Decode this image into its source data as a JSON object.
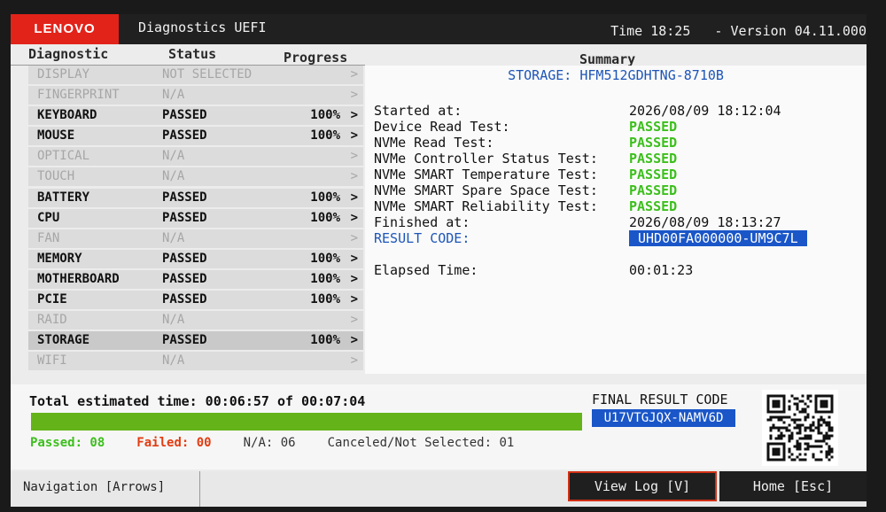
{
  "header": {
    "logo": "LENOVO",
    "title": "Diagnostics UEFI",
    "time": "Time 18:25",
    "version": "Version 04.11.000"
  },
  "columns": {
    "diagnostic": "Diagnostic",
    "status": "Status",
    "progress": "Progress",
    "summary": "Summary"
  },
  "devices": [
    {
      "name": "DISPLAY",
      "status": "NOT SELECTED",
      "progress": "",
      "enabled": false
    },
    {
      "name": "FINGERPRINT",
      "status": "N/A",
      "progress": "",
      "enabled": false
    },
    {
      "name": "KEYBOARD",
      "status": "PASSED",
      "progress": "100%",
      "enabled": true
    },
    {
      "name": "MOUSE",
      "status": "PASSED",
      "progress": "100%",
      "enabled": true
    },
    {
      "name": "OPTICAL",
      "status": "N/A",
      "progress": "",
      "enabled": false
    },
    {
      "name": "TOUCH",
      "status": "N/A",
      "progress": "",
      "enabled": false
    },
    {
      "name": "BATTERY",
      "status": "PASSED",
      "progress": "100%",
      "enabled": true
    },
    {
      "name": "CPU",
      "status": "PASSED",
      "progress": "100%",
      "enabled": true
    },
    {
      "name": "FAN",
      "status": "N/A",
      "progress": "",
      "enabled": false
    },
    {
      "name": "MEMORY",
      "status": "PASSED",
      "progress": "100%",
      "enabled": true
    },
    {
      "name": "MOTHERBOARD",
      "status": "PASSED",
      "progress": "100%",
      "enabled": true
    },
    {
      "name": "PCIE",
      "status": "PASSED",
      "progress": "100%",
      "enabled": true
    },
    {
      "name": "RAID",
      "status": "N/A",
      "progress": "",
      "enabled": false
    },
    {
      "name": "STORAGE",
      "status": "PASSED",
      "progress": "100%",
      "enabled": true,
      "selected": true
    },
    {
      "name": "WIFI",
      "status": "N/A",
      "progress": "",
      "enabled": false
    }
  ],
  "summary": {
    "device": "STORAGE: HFM512GDHTNG-8710B",
    "started_label": "Started at:",
    "started_value": "2026/08/09 18:12:04",
    "tests": [
      {
        "label": "Device Read Test:",
        "result": "PASSED"
      },
      {
        "label": "NVMe Read Test:",
        "result": "PASSED"
      },
      {
        "label": "NVMe Controller Status Test:",
        "result": "PASSED"
      },
      {
        "label": "NVMe SMART Temperature Test:",
        "result": "PASSED"
      },
      {
        "label": "NVMe SMART Spare Space Test:",
        "result": "PASSED"
      },
      {
        "label": "NVMe SMART Reliability Test:",
        "result": "PASSED"
      }
    ],
    "finished_label": "Finished at:",
    "finished_value": "2026/08/09 18:13:27",
    "result_code_label": "RESULT CODE:",
    "result_code_value": "UHD00FA000000-UM9C7L",
    "elapsed_label": "Elapsed Time:",
    "elapsed_value": "00:01:23"
  },
  "totals": {
    "estimated_text": "Total estimated time: 00:06:57 of 00:07:04",
    "progress_fraction": 1.0,
    "passed": "Passed: 08",
    "failed": "Failed: 00",
    "na": "N/A: 06",
    "canceled": "Canceled/Not Selected: 01",
    "final_label": "FINAL RESULT CODE",
    "final_code": "U17VTGJQX-NAMV6D"
  },
  "footer": {
    "navigation": "Navigation [Arrows]",
    "view_log": "View Log [V]",
    "home": "Home [Esc]"
  },
  "colors": {
    "brand_red": "#e2231a",
    "pass_green": "#3cbf1c",
    "fail_red": "#e23c12",
    "code_blue": "#1a56c8",
    "progress_green": "#64b318"
  }
}
